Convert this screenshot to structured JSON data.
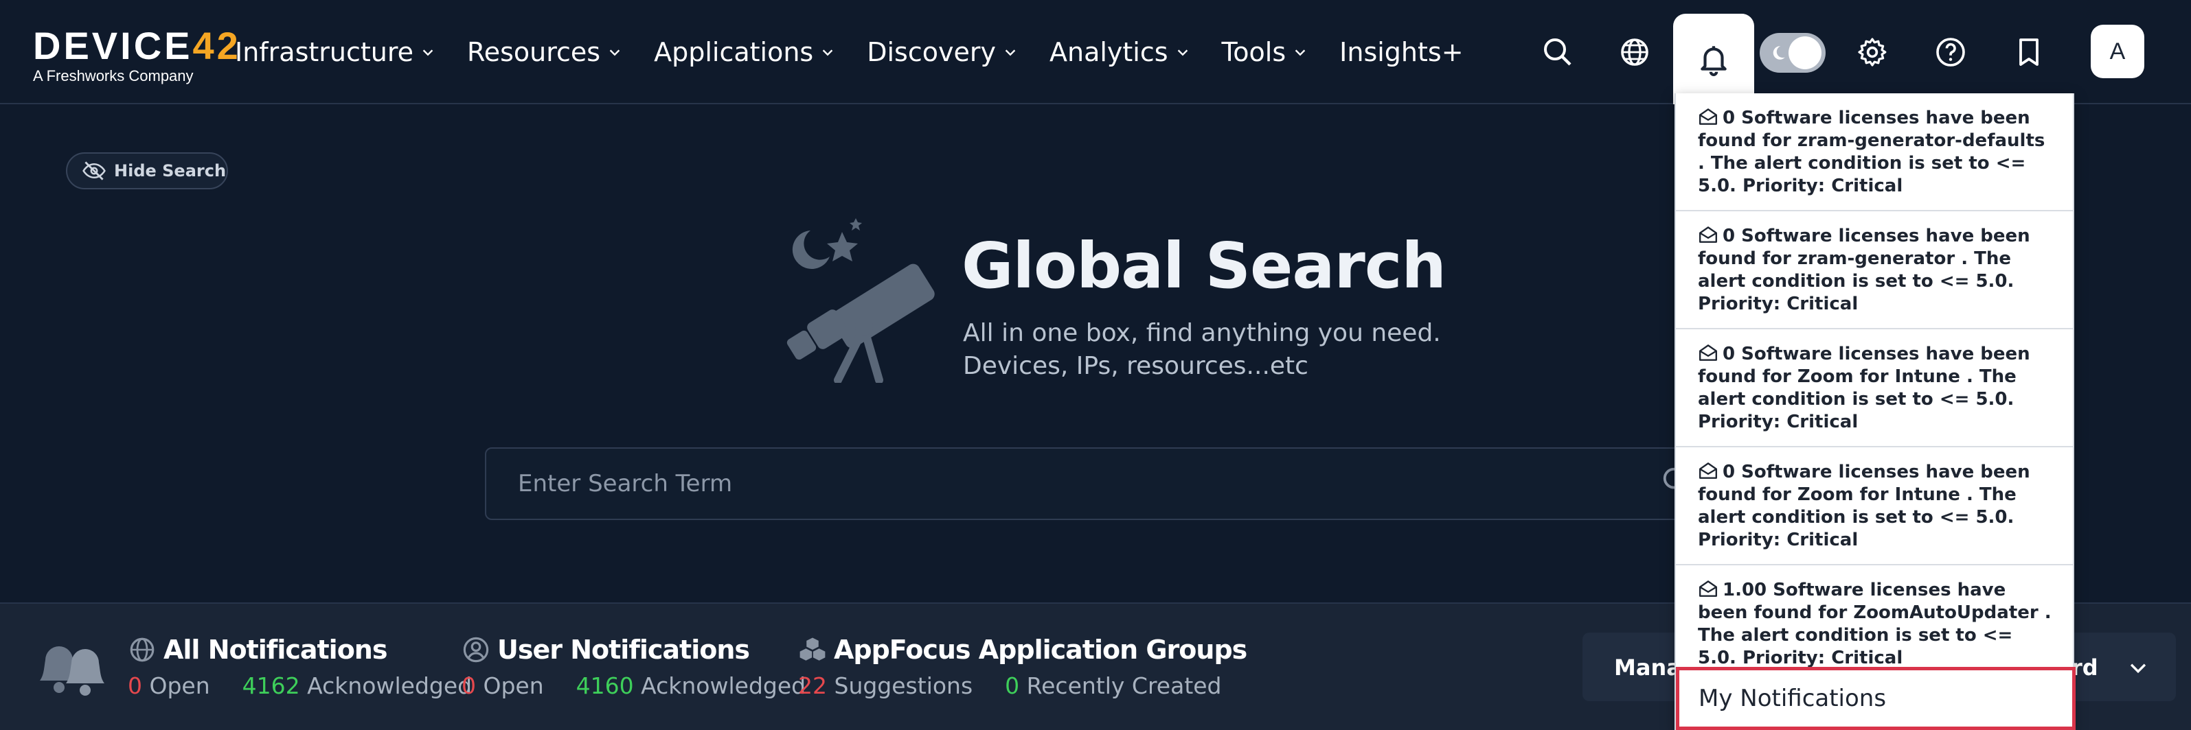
{
  "logo": {
    "main_a": "DEVICE",
    "main_b": "42",
    "sub": "A Freshworks Company"
  },
  "nav": {
    "items": [
      {
        "label": "Infrastructure",
        "has_dropdown": true
      },
      {
        "label": "Resources",
        "has_dropdown": true
      },
      {
        "label": "Applications",
        "has_dropdown": true
      },
      {
        "label": "Discovery",
        "has_dropdown": true
      },
      {
        "label": "Analytics",
        "has_dropdown": true
      },
      {
        "label": "Tools",
        "has_dropdown": true
      },
      {
        "label": "Insights+",
        "has_dropdown": false
      }
    ],
    "icons": [
      "search-icon",
      "globe-icon",
      "bell-icon",
      "theme-toggle",
      "gear-icon",
      "help-icon",
      "bookmark-icon"
    ],
    "avatar": "A"
  },
  "hero": {
    "hide_search": "Hide Search",
    "title": "Global Search",
    "subtitle_line1": "All in one box, find anything you need.",
    "subtitle_line2": "Devices, IPs, resources...etc",
    "search_placeholder": "Enter Search Term"
  },
  "stats": {
    "all": {
      "title": "All Notifications",
      "open_count": "0",
      "open_label": "Open",
      "ack_count": "4162",
      "ack_label": "Acknowledged"
    },
    "user": {
      "title": "User Notifications",
      "open_count": "0",
      "open_label": "Open",
      "ack_count": "4160",
      "ack_label": "Acknowledged"
    },
    "appfocus": {
      "title": "AppFocus Application Groups",
      "sugg_count": "22",
      "sugg_label": "Suggestions",
      "created_count": "0",
      "created_label": "Recently Created"
    },
    "manage_left": "Manag",
    "manage_right": "rd"
  },
  "notifications": [
    {
      "text": "0 Software licenses have been found for zram-generator-defaults . The alert condition is set to <= 5.0. Priority: Critical"
    },
    {
      "text": "0 Software licenses have been found for zram-generator . The alert condition is set to <= 5.0. Priority: Critical"
    },
    {
      "text": "0 Software licenses have been found for Zoom for Intune . The alert condition is set to <= 5.0. Priority: Critical"
    },
    {
      "text": "0 Software licenses have been found for Zoom for Intune . The alert condition is set to <= 5.0. Priority: Critical"
    },
    {
      "text": "1.00 Software licenses have been found for ZoomAutoUpdater . The alert condition is set to <= 5.0. Priority: Critical"
    }
  ],
  "my_notifications": "My Notifications",
  "colors": {
    "background": "#0f1a2b",
    "bottombar": "#1a2536",
    "accent": "#f5a623",
    "open_red": "#e5484d",
    "ack_green": "#3ecf5a",
    "highlight": "#d9344a"
  }
}
